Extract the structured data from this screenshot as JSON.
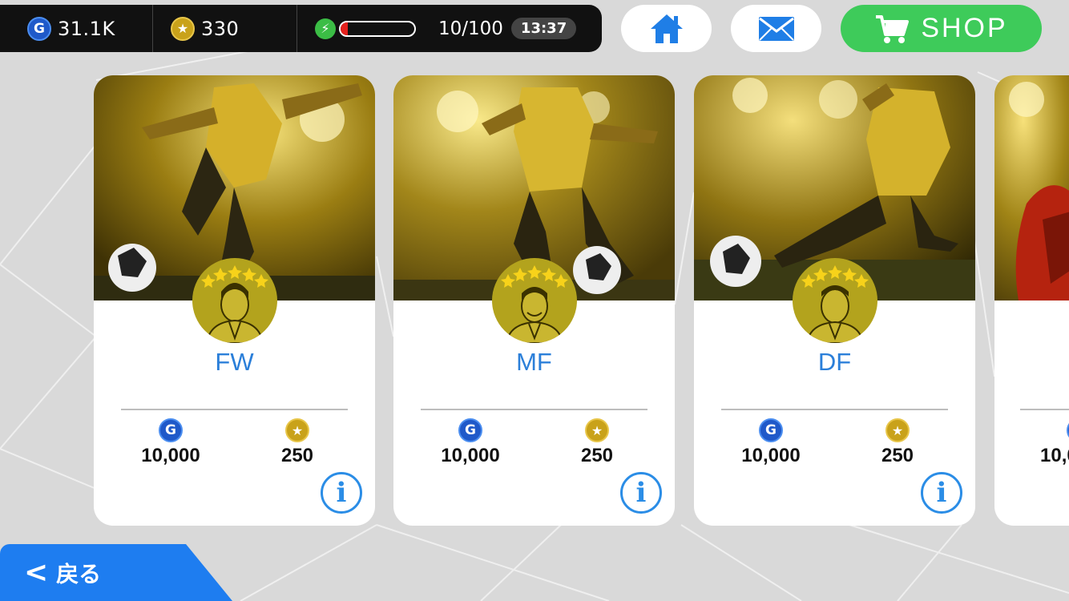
{
  "status": {
    "gp_value": "31.1K",
    "coin_value": "330",
    "energy_fraction": 0.1,
    "energy_count": "10/100",
    "timer": "13:37"
  },
  "shop": {
    "label": "SHOP"
  },
  "cards": [
    {
      "position": "FW",
      "gp_price": "10,000",
      "coin_price": "250"
    },
    {
      "position": "MF",
      "gp_price": "10,000",
      "coin_price": "250"
    },
    {
      "position": "DF",
      "gp_price": "10,000",
      "coin_price": "250"
    },
    {
      "gp_price_partial": "10,0"
    }
  ],
  "icons": {
    "gp": "G",
    "coin": "★",
    "info": "i"
  },
  "back": {
    "label": "戻る"
  },
  "colors": {
    "accent_blue": "#2b7fd9",
    "shop_green": "#3ecb5a",
    "back_blue": "#1e7df0",
    "gold": "#b3a31d"
  }
}
